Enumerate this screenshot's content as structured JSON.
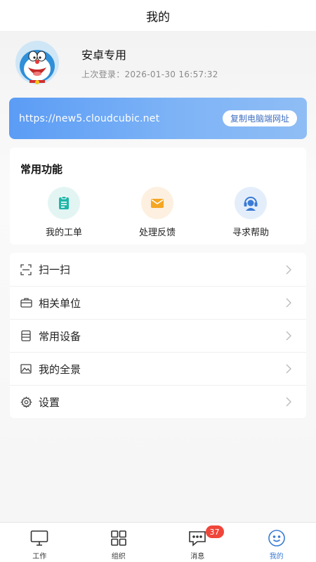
{
  "header": {
    "title": "我的"
  },
  "profile": {
    "name": "安卓专用",
    "last_login": "上次登录：2026-01-30 16:57:32"
  },
  "url_banner": {
    "url": "https://new5.cloudcubic.net",
    "copy_label": "复制电脑端网址"
  },
  "functions": {
    "title": "常用功能",
    "items": [
      {
        "label": "我的工单",
        "icon": "clipboard-icon",
        "color": "#1fb5a8"
      },
      {
        "label": "处理反馈",
        "icon": "mail-icon",
        "color": "#f5a623"
      },
      {
        "label": "寻求帮助",
        "icon": "support-agent-icon",
        "color": "#3a7bd5"
      }
    ]
  },
  "menu": {
    "items": [
      {
        "label": "扫一扫",
        "icon": "scan-icon"
      },
      {
        "label": "相关单位",
        "icon": "briefcase-icon"
      },
      {
        "label": "常用设备",
        "icon": "device-icon"
      },
      {
        "label": "我的全景",
        "icon": "image-icon"
      },
      {
        "label": "设置",
        "icon": "gear-icon"
      }
    ]
  },
  "tabbar": {
    "tabs": [
      {
        "label": "工作",
        "icon": "monitor-icon"
      },
      {
        "label": "组织",
        "icon": "grid-icon"
      },
      {
        "label": "消息",
        "icon": "chat-icon",
        "badge": "37"
      },
      {
        "label": "我的",
        "icon": "user-icon",
        "active": true
      }
    ]
  },
  "colors": {
    "accent": "#3a7bd5",
    "banner_start": "#5b9cf5",
    "banner_end": "#8fbdf5",
    "badge": "#f0453a"
  }
}
